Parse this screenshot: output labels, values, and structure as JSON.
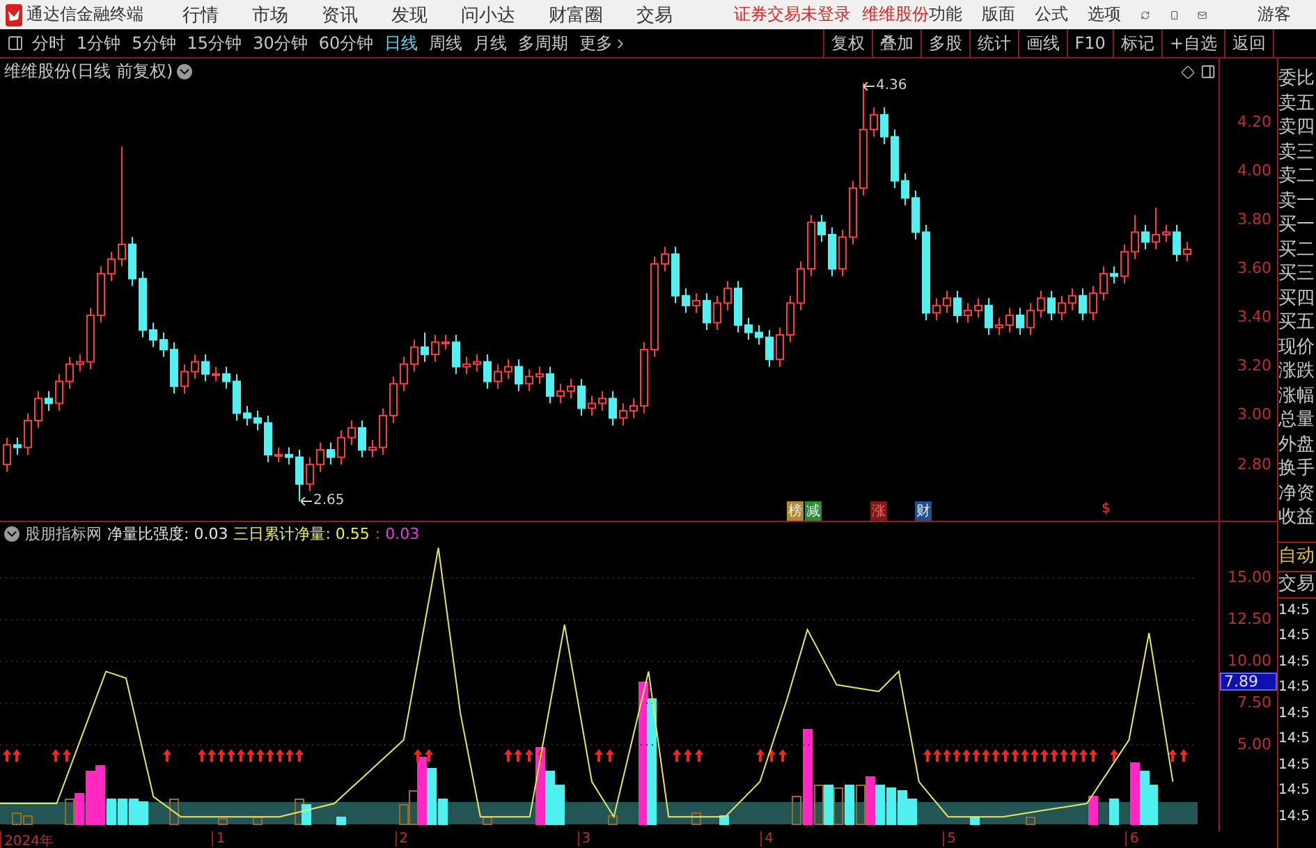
{
  "title_bar": {
    "app_name": "通达信金融终端",
    "menu": [
      "行情",
      "市场",
      "资讯",
      "发现",
      "问小达",
      "财富圈",
      "交易"
    ],
    "login_status": "证券交易未登录",
    "stock_name": "维维股份",
    "menu_right": [
      "功能",
      "版面",
      "公式",
      "选项"
    ],
    "user": "游客"
  },
  "toolbar": {
    "periods": [
      {
        "label": "分时",
        "selected": false
      },
      {
        "label": "1分钟",
        "selected": false
      },
      {
        "label": "5分钟",
        "selected": false
      },
      {
        "label": "15分钟",
        "selected": false
      },
      {
        "label": "30分钟",
        "selected": false
      },
      {
        "label": "60分钟",
        "selected": false
      },
      {
        "label": "日线",
        "selected": true
      },
      {
        "label": "周线",
        "selected": false
      },
      {
        "label": "月线",
        "selected": false
      },
      {
        "label": "多周期",
        "selected": false
      }
    ],
    "more": "更多",
    "actions": [
      "复权",
      "叠加",
      "多股",
      "统计",
      "画线",
      "F10",
      "标记",
      "+自选",
      "返回"
    ]
  },
  "main_chart": {
    "title": "维维股份(日线 前复权)",
    "high_label": "4.36",
    "low_label": "2.65",
    "events": [
      {
        "label": "榜",
        "color": "#b08a30"
      },
      {
        "label": "减",
        "color": "#2e8b3a"
      },
      {
        "label": "涨",
        "color": "#7a1a1a"
      },
      {
        "label": "财",
        "color": "#1f4f8f"
      },
      {
        "label": "$",
        "color": "#000000"
      }
    ],
    "chart_data": {
      "type": "candlestick",
      "ylim": [
        2.57,
        4.46
      ],
      "yticks": [
        {
          "value": 4.2,
          "label": "4.20"
        },
        {
          "value": 4.0,
          "label": "4.00"
        },
        {
          "value": 3.8,
          "label": "3.80"
        },
        {
          "value": 3.6,
          "label": "3.60"
        },
        {
          "value": 3.4,
          "label": "3.40"
        },
        {
          "value": 3.2,
          "label": "3.20"
        },
        {
          "value": 3.0,
          "label": "3.00"
        },
        {
          "value": 2.8,
          "label": "2.80"
        }
      ],
      "ohlc": [
        [
          2.8,
          2.91,
          2.77,
          2.88
        ],
        [
          2.88,
          2.91,
          2.84,
          2.87
        ],
        [
          2.87,
          3.01,
          2.84,
          2.98
        ],
        [
          2.98,
          3.1,
          2.95,
          3.07
        ],
        [
          3.07,
          3.1,
          3.02,
          3.05
        ],
        [
          3.05,
          3.17,
          3.02,
          3.14
        ],
        [
          3.14,
          3.24,
          3.11,
          3.21
        ],
        [
          3.21,
          3.25,
          3.18,
          3.22
        ],
        [
          3.22,
          3.44,
          3.19,
          3.41
        ],
        [
          3.41,
          3.61,
          3.38,
          3.58
        ],
        [
          3.58,
          3.67,
          3.55,
          3.64
        ],
        [
          3.64,
          4.1,
          3.61,
          3.7
        ],
        [
          3.7,
          3.73,
          3.53,
          3.56
        ],
        [
          3.56,
          3.59,
          3.32,
          3.35
        ],
        [
          3.35,
          3.38,
          3.28,
          3.31
        ],
        [
          3.31,
          3.34,
          3.24,
          3.27
        ],
        [
          3.27,
          3.3,
          3.09,
          3.12
        ],
        [
          3.12,
          3.21,
          3.09,
          3.18
        ],
        [
          3.18,
          3.25,
          3.15,
          3.22
        ],
        [
          3.22,
          3.25,
          3.14,
          3.17
        ],
        [
          3.17,
          3.2,
          3.14,
          3.17
        ],
        [
          3.17,
          3.2,
          3.11,
          3.14
        ],
        [
          3.14,
          3.17,
          2.98,
          3.01
        ],
        [
          3.01,
          3.04,
          2.96,
          2.99
        ],
        [
          2.99,
          3.02,
          2.94,
          2.97
        ],
        [
          2.97,
          3.0,
          2.81,
          2.84
        ],
        [
          2.84,
          2.87,
          2.81,
          2.84
        ],
        [
          2.84,
          2.87,
          2.8,
          2.83
        ],
        [
          2.83,
          2.86,
          2.65,
          2.72
        ],
        [
          2.72,
          2.83,
          2.69,
          2.8
        ],
        [
          2.8,
          2.89,
          2.77,
          2.86
        ],
        [
          2.86,
          2.89,
          2.8,
          2.83
        ],
        [
          2.83,
          2.94,
          2.8,
          2.91
        ],
        [
          2.91,
          2.98,
          2.88,
          2.95
        ],
        [
          2.95,
          2.98,
          2.83,
          2.86
        ],
        [
          2.86,
          2.9,
          2.83,
          2.87
        ],
        [
          2.87,
          3.03,
          2.84,
          3.0
        ],
        [
          3.0,
          3.16,
          2.97,
          3.13
        ],
        [
          3.13,
          3.24,
          3.1,
          3.21
        ],
        [
          3.21,
          3.31,
          3.18,
          3.28
        ],
        [
          3.28,
          3.34,
          3.22,
          3.25
        ],
        [
          3.25,
          3.33,
          3.22,
          3.3
        ],
        [
          3.3,
          3.33,
          3.27,
          3.3
        ],
        [
          3.3,
          3.33,
          3.17,
          3.2
        ],
        [
          3.2,
          3.24,
          3.17,
          3.21
        ],
        [
          3.21,
          3.25,
          3.18,
          3.22
        ],
        [
          3.22,
          3.25,
          3.11,
          3.14
        ],
        [
          3.14,
          3.21,
          3.11,
          3.18
        ],
        [
          3.18,
          3.23,
          3.15,
          3.2
        ],
        [
          3.2,
          3.23,
          3.1,
          3.13
        ],
        [
          3.13,
          3.19,
          3.1,
          3.16
        ],
        [
          3.16,
          3.2,
          3.13,
          3.17
        ],
        [
          3.17,
          3.2,
          3.05,
          3.08
        ],
        [
          3.08,
          3.13,
          3.05,
          3.1
        ],
        [
          3.1,
          3.15,
          3.07,
          3.12
        ],
        [
          3.12,
          3.15,
          3.0,
          3.03
        ],
        [
          3.03,
          3.08,
          3.0,
          3.05
        ],
        [
          3.05,
          3.1,
          3.02,
          3.07
        ],
        [
          3.07,
          3.1,
          2.96,
          2.99
        ],
        [
          2.99,
          3.05,
          2.96,
          3.02
        ],
        [
          3.02,
          3.07,
          2.99,
          3.04
        ],
        [
          3.04,
          3.3,
          3.01,
          3.27
        ],
        [
          3.27,
          3.65,
          3.24,
          3.62
        ],
        [
          3.62,
          3.69,
          3.59,
          3.66
        ],
        [
          3.66,
          3.69,
          3.46,
          3.49
        ],
        [
          3.49,
          3.52,
          3.42,
          3.45
        ],
        [
          3.45,
          3.5,
          3.42,
          3.47
        ],
        [
          3.47,
          3.5,
          3.35,
          3.38
        ],
        [
          3.38,
          3.49,
          3.35,
          3.46
        ],
        [
          3.46,
          3.55,
          3.43,
          3.52
        ],
        [
          3.52,
          3.55,
          3.34,
          3.37
        ],
        [
          3.37,
          3.4,
          3.31,
          3.34
        ],
        [
          3.34,
          3.37,
          3.29,
          3.32
        ],
        [
          3.32,
          3.35,
          3.2,
          3.23
        ],
        [
          3.23,
          3.36,
          3.2,
          3.33
        ],
        [
          3.33,
          3.49,
          3.3,
          3.46
        ],
        [
          3.46,
          3.63,
          3.43,
          3.6
        ],
        [
          3.6,
          3.82,
          3.57,
          3.79
        ],
        [
          3.79,
          3.82,
          3.71,
          3.74
        ],
        [
          3.74,
          3.77,
          3.57,
          3.6
        ],
        [
          3.6,
          3.76,
          3.57,
          3.73
        ],
        [
          3.73,
          3.96,
          3.7,
          3.93
        ],
        [
          3.93,
          4.36,
          3.9,
          4.17
        ],
        [
          4.17,
          4.26,
          4.14,
          4.23
        ],
        [
          4.23,
          4.26,
          4.11,
          4.14
        ],
        [
          4.14,
          4.17,
          3.93,
          3.96
        ],
        [
          3.96,
          3.99,
          3.86,
          3.89
        ],
        [
          3.89,
          3.92,
          3.72,
          3.75
        ],
        [
          3.75,
          3.78,
          3.39,
          3.42
        ],
        [
          3.42,
          3.48,
          3.39,
          3.45
        ],
        [
          3.45,
          3.51,
          3.42,
          3.48
        ],
        [
          3.48,
          3.51,
          3.38,
          3.41
        ],
        [
          3.41,
          3.46,
          3.38,
          3.43
        ],
        [
          3.43,
          3.48,
          3.4,
          3.45
        ],
        [
          3.45,
          3.48,
          3.33,
          3.36
        ],
        [
          3.36,
          3.4,
          3.33,
          3.37
        ],
        [
          3.37,
          3.44,
          3.34,
          3.41
        ],
        [
          3.41,
          3.44,
          3.33,
          3.36
        ],
        [
          3.36,
          3.46,
          3.33,
          3.43
        ],
        [
          3.43,
          3.51,
          3.4,
          3.48
        ],
        [
          3.48,
          3.51,
          3.39,
          3.42
        ],
        [
          3.42,
          3.49,
          3.39,
          3.46
        ],
        [
          3.46,
          3.52,
          3.43,
          3.49
        ],
        [
          3.49,
          3.52,
          3.39,
          3.42
        ],
        [
          3.42,
          3.53,
          3.39,
          3.5
        ],
        [
          3.5,
          3.61,
          3.47,
          3.58
        ],
        [
          3.58,
          3.61,
          3.54,
          3.57
        ],
        [
          3.57,
          3.7,
          3.54,
          3.67
        ],
        [
          3.67,
          3.82,
          3.64,
          3.75
        ],
        [
          3.75,
          3.78,
          3.68,
          3.71
        ],
        [
          3.71,
          3.85,
          3.68,
          3.74
        ],
        [
          3.74,
          3.78,
          3.71,
          3.75
        ],
        [
          3.75,
          3.78,
          3.63,
          3.66
        ],
        [
          3.66,
          3.71,
          3.63,
          3.68
        ]
      ]
    }
  },
  "indicator": {
    "legend": [
      {
        "text": "股朋指标网",
        "color": "#c0c0c0"
      },
      {
        "text": "净量比强度: 0.03",
        "color": "#e8e8e8"
      },
      {
        "text": "三日累计净量: 0.55",
        "color": "#f0f060"
      },
      {
        "text": ": 0.03",
        "color": "#e040e0"
      }
    ],
    "current_value": "7.89",
    "chart_data": {
      "type": "line",
      "grid": true,
      "xlim": [
        -0.2,
        6.47
      ],
      "ylim": [
        -0.17,
        18.33
      ],
      "x": [
        -0.2,
        0.11,
        0.38,
        0.49,
        0.64,
        0.79,
        1.33,
        1.63,
        2.01,
        2.2,
        2.32,
        2.43,
        2.7,
        2.89,
        3.04,
        3.16,
        3.35,
        3.46,
        3.77,
        3.96,
        4.11,
        4.22,
        4.38,
        4.61,
        4.72,
        4.83,
        4.99,
        5.29,
        5.75,
        5.98,
        6.09,
        6.22
      ],
      "series": [
        {
          "color": "#e8e860",
          "values": [
            1.5,
            1.5,
            9.4,
            9.0,
            1.9,
            0.7,
            0.7,
            1.5,
            5.3,
            16.8,
            6.9,
            0.7,
            0.7,
            12.2,
            2.8,
            0.7,
            9.4,
            0.7,
            0.7,
            2.8,
            7.8,
            11.9,
            8.6,
            8.2,
            9.4,
            2.8,
            0.7,
            0.7,
            1.5,
            5.3,
            11.7,
            2.8
          ]
        }
      ],
      "xticks": [
        {
          "value": 1,
          "label": "1"
        },
        {
          "value": 2,
          "label": "2"
        },
        {
          "value": 3,
          "label": "3"
        },
        {
          "value": 4,
          "label": "4"
        },
        {
          "value": 5,
          "label": "5"
        },
        {
          "value": 6,
          "label": "6"
        }
      ],
      "yticks": [
        {
          "value": 15,
          "label": "15.00"
        },
        {
          "value": 12.5,
          "label": "12.50"
        },
        {
          "value": 10,
          "label": "10.00"
        },
        {
          "value": 7.5,
          "label": "7.50"
        },
        {
          "value": 5,
          "label": "5.00"
        }
      ]
    }
  },
  "x_axis": {
    "year_label": "2024年"
  },
  "quote_panel": {
    "fields": [
      "委比",
      "卖五",
      "卖四",
      "卖三",
      "卖二",
      "卖一",
      "买一",
      "买二",
      "买三",
      "买四",
      "买五",
      "现价",
      "涨跌",
      "涨幅",
      "总量",
      "外盘",
      "换手",
      "净资",
      "收益"
    ],
    "auto": "自动",
    "trade": "交易",
    "times": [
      "14:5",
      "14:5",
      "14:5",
      "14:5",
      "14:5",
      "14:5",
      "14:5",
      "14:5",
      "14:5"
    ]
  }
}
